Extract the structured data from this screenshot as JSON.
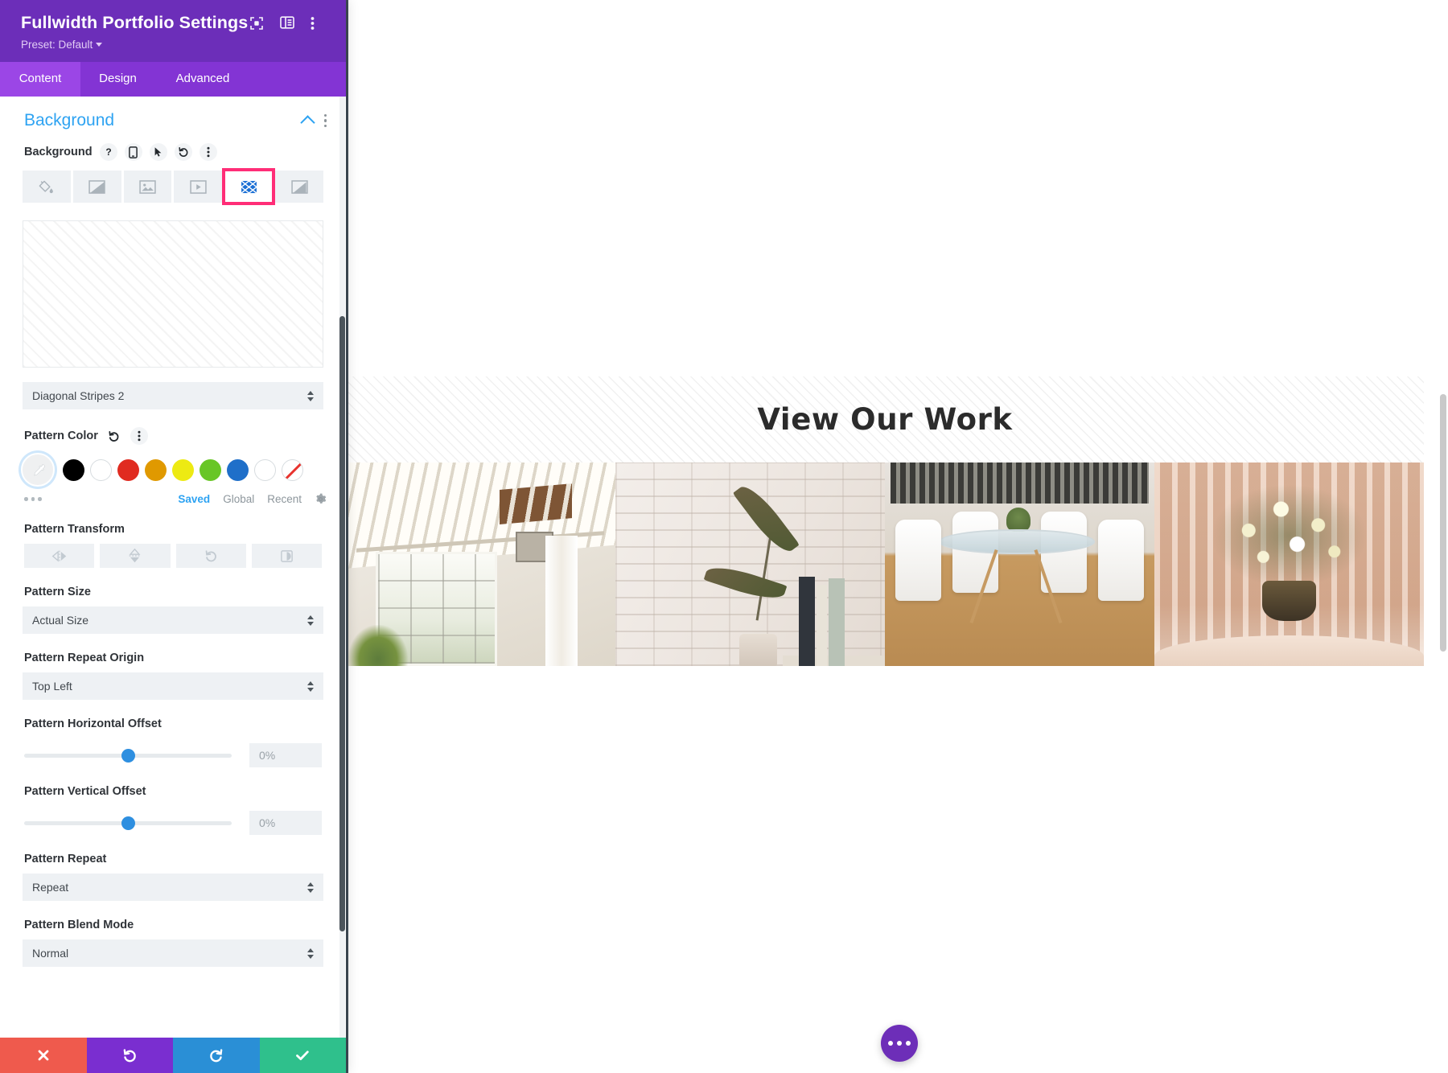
{
  "header": {
    "title": "Fullwidth Portfolio Settings",
    "preset_label": "Preset: Default",
    "icons": [
      "focus-target-icon",
      "layout-panel-icon",
      "more-vertical-icon"
    ]
  },
  "tabs": [
    {
      "label": "Content",
      "active": true
    },
    {
      "label": "Design",
      "active": false
    },
    {
      "label": "Advanced",
      "active": false
    }
  ],
  "section": {
    "title": "Background",
    "collapse_icon": "chevron-up-icon",
    "options_icon": "more-vertical-icon"
  },
  "background_field": {
    "label": "Background",
    "tool_icons": [
      "help-icon",
      "responsive-phone-icon",
      "hover-cursor-icon",
      "reset-icon",
      "more-vertical-icon"
    ],
    "types": [
      {
        "name": "background-color",
        "icon": "paint-bucket-icon",
        "active": false
      },
      {
        "name": "background-gradient",
        "icon": "gradient-icon",
        "active": false
      },
      {
        "name": "background-image",
        "icon": "image-icon",
        "active": false
      },
      {
        "name": "background-video",
        "icon": "video-icon",
        "active": false
      },
      {
        "name": "background-pattern",
        "icon": "pattern-icon",
        "active": true
      },
      {
        "name": "background-mask",
        "icon": "mask-icon",
        "active": false
      }
    ],
    "highlight_color": "#ff2d77"
  },
  "pattern_style": {
    "value": "Diagonal Stripes 2"
  },
  "pattern_color": {
    "label": "Pattern Color",
    "reset_icon": "reset-icon",
    "options_icon": "more-vertical-icon",
    "swatches": [
      {
        "name": "color-picker",
        "color": "#eff0f1",
        "icon": "eyedropper-icon",
        "selected": true
      },
      {
        "name": "black",
        "color": "#000000"
      },
      {
        "name": "white",
        "color": "#ffffff"
      },
      {
        "name": "red",
        "color": "#e02b20"
      },
      {
        "name": "orange",
        "color": "#e09900"
      },
      {
        "name": "yellow",
        "color": "#edea13"
      },
      {
        "name": "green",
        "color": "#68c626"
      },
      {
        "name": "blue",
        "color": "#1f6fc9"
      },
      {
        "name": "white-2",
        "color": "#ffffff"
      },
      {
        "name": "transparent",
        "color": "none"
      }
    ],
    "meta_tabs": [
      {
        "label": "Saved",
        "selected": true
      },
      {
        "label": "Global",
        "selected": false
      },
      {
        "label": "Recent",
        "selected": false
      }
    ],
    "settings_icon": "gear-icon"
  },
  "pattern_transform": {
    "label": "Pattern Transform",
    "buttons": [
      {
        "name": "flip-horizontal",
        "icon": "flip-horizontal-icon"
      },
      {
        "name": "flip-vertical",
        "icon": "flip-vertical-icon"
      },
      {
        "name": "rotate",
        "icon": "rotate-icon"
      },
      {
        "name": "invert",
        "icon": "invert-icon"
      }
    ]
  },
  "pattern_size": {
    "label": "Pattern Size",
    "value": "Actual Size"
  },
  "pattern_repeat_origin": {
    "label": "Pattern Repeat Origin",
    "value": "Top Left"
  },
  "pattern_horizontal_offset": {
    "label": "Pattern Horizontal Offset",
    "value": "0%",
    "knob_percent": 50
  },
  "pattern_vertical_offset": {
    "label": "Pattern Vertical Offset",
    "value": "0%",
    "knob_percent": 50
  },
  "pattern_repeat": {
    "label": "Pattern Repeat",
    "value": "Repeat"
  },
  "pattern_blend_mode": {
    "label": "Pattern Blend Mode",
    "value": "Normal"
  },
  "footer": {
    "buttons": [
      {
        "name": "cancel",
        "icon": "close-x-icon",
        "color": "#ef5a4d"
      },
      {
        "name": "undo",
        "icon": "undo-icon",
        "color": "#7a2ed0"
      },
      {
        "name": "redo",
        "icon": "redo-icon",
        "color": "#2a8fd6"
      },
      {
        "name": "save",
        "icon": "checkmark-icon",
        "color": "#2fc08c"
      }
    ]
  },
  "canvas": {
    "hero_heading": "View Our Work",
    "portfolio_items": [
      {
        "name": "portfolio-item-1",
        "alt": "white loft interior with ceiling beams and window"
      },
      {
        "name": "portfolio-item-2",
        "alt": "plant and books against white brick wall"
      },
      {
        "name": "portfolio-item-3",
        "alt": "glass dining table with white chairs"
      },
      {
        "name": "portfolio-item-4",
        "alt": "flower bouquet in vase before peach curtain"
      }
    ],
    "fab_icon": "more-horizontal-icon",
    "fab_color": "#6d2eb8"
  }
}
